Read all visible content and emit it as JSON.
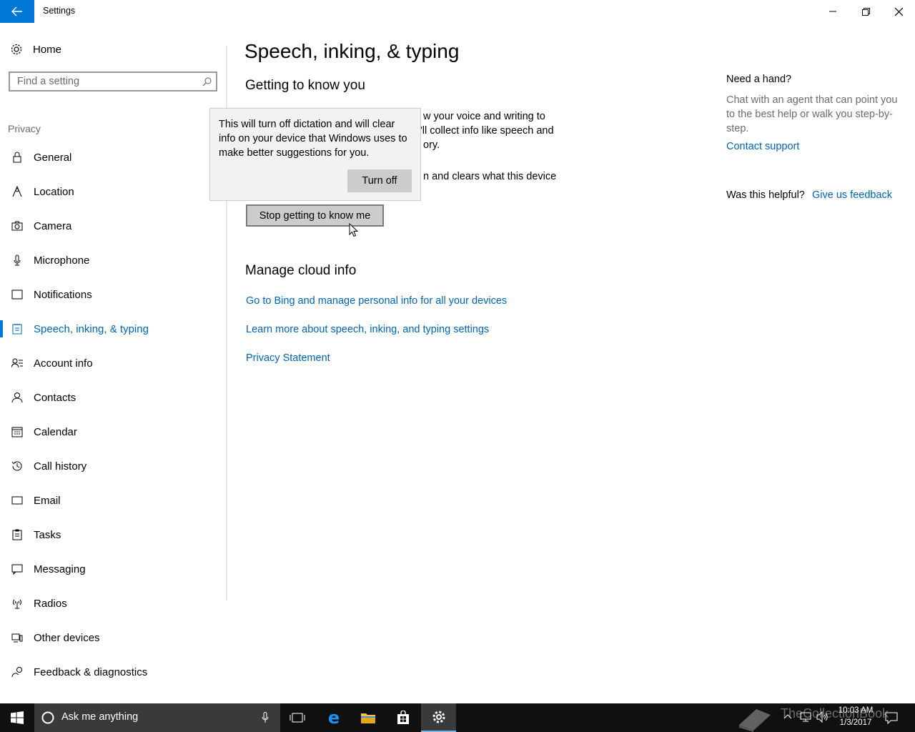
{
  "window": {
    "title": "Settings",
    "controls": [
      "minimize-icon",
      "restore-icon",
      "close-icon"
    ]
  },
  "sidebar": {
    "home_label": "Home",
    "search_placeholder": "Find a setting",
    "section_title": "Privacy",
    "items": [
      {
        "label": "General",
        "icon": "lock-icon"
      },
      {
        "label": "Location",
        "icon": "location-icon"
      },
      {
        "label": "Camera",
        "icon": "camera-icon"
      },
      {
        "label": "Microphone",
        "icon": "microphone-icon"
      },
      {
        "label": "Notifications",
        "icon": "notifications-icon"
      },
      {
        "label": "Speech, inking, & typing",
        "icon": "speech-inking-icon",
        "selected": true
      },
      {
        "label": "Account info",
        "icon": "account-info-icon"
      },
      {
        "label": "Contacts",
        "icon": "contacts-icon"
      },
      {
        "label": "Calendar",
        "icon": "calendar-icon"
      },
      {
        "label": "Call history",
        "icon": "history-icon"
      },
      {
        "label": "Email",
        "icon": "email-icon"
      },
      {
        "label": "Tasks",
        "icon": "tasks-icon"
      },
      {
        "label": "Messaging",
        "icon": "messaging-icon"
      },
      {
        "label": "Radios",
        "icon": "radios-icon"
      },
      {
        "label": "Other devices",
        "icon": "devices-icon"
      },
      {
        "label": "Feedback & diagnostics",
        "icon": "feedback-icon"
      }
    ]
  },
  "main": {
    "title": "Speech, inking, & typing",
    "getting_to_know": {
      "heading": "Getting to know you",
      "line1": "w your voice and writing to",
      "line2": "'ll collect info like speech and",
      "line3": "ory.",
      "line4": "n and clears what this device",
      "button": "Stop getting to know me"
    },
    "flyout": {
      "message": "This will turn off dictation and will clear info on your device that Windows uses to make better suggestions for you.",
      "button": "Turn off"
    },
    "cloud": {
      "heading": "Manage cloud info",
      "links": [
        "Go to Bing and manage personal info for all your devices",
        "Learn more about speech, inking, and typing settings",
        "Privacy Statement"
      ]
    }
  },
  "right_panel": {
    "heading": "Need a hand?",
    "description": "Chat with an agent that can point you to the best help or walk you step-by-step.",
    "contact_link": "Contact support",
    "helpful_label": "Was this helpful?",
    "feedback_link": "Give us feedback"
  },
  "taskbar": {
    "search_placeholder": "Ask me anything",
    "time": "10:03 AM",
    "date": "1/3/2017",
    "watermark": "TheCollectionBook"
  },
  "colors": {
    "accent": "#0078d7",
    "link": "#0063b1",
    "taskbar": "#101010"
  }
}
